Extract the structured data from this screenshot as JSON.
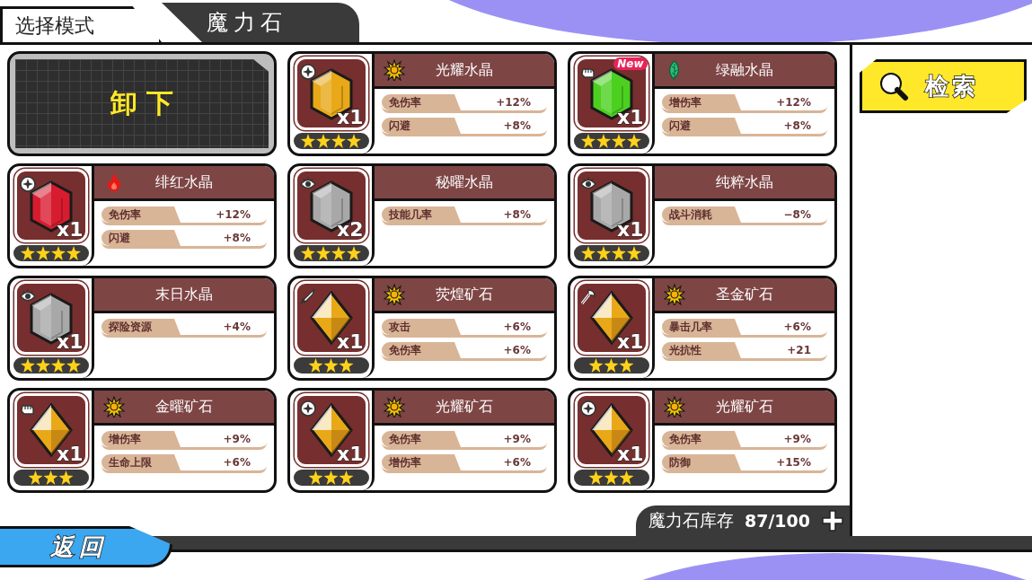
{
  "header": {
    "mode_tab": "选择模式",
    "title": "魔力石"
  },
  "unequip_button": "卸 下",
  "stones": [
    {
      "name": "光耀水晶",
      "element": {
        "kind": "sun"
      },
      "badge": {
        "kind": "target"
      },
      "gem": {
        "kind": "crystal",
        "color": "#e8a818"
      },
      "count": "x1",
      "stars": 4,
      "stats": [
        {
          "label": "免伤率",
          "value": "+12%"
        },
        {
          "label": "闪避",
          "value": "+8%"
        }
      ]
    },
    {
      "name": "绿融水晶",
      "element": {
        "kind": "leaf"
      },
      "badge": {
        "kind": "fist"
      },
      "gem": {
        "kind": "crystal",
        "color": "#4cd020"
      },
      "count": "x1",
      "stars": 4,
      "new_label": "New",
      "stats": [
        {
          "label": "增伤率",
          "value": "+12%"
        },
        {
          "label": "闪避",
          "value": "+8%"
        }
      ]
    },
    {
      "name": "绯红水晶",
      "element": {
        "kind": "fire"
      },
      "badge": {
        "kind": "target"
      },
      "gem": {
        "kind": "crystal",
        "color": "#d81c30"
      },
      "count": "x1",
      "stars": 4,
      "stats": [
        {
          "label": "免伤率",
          "value": "+12%"
        },
        {
          "label": "闪避",
          "value": "+8%"
        }
      ]
    },
    {
      "name": "秘曜水晶",
      "badge": {
        "kind": "eye"
      },
      "gem": {
        "kind": "crystal",
        "color": "#a8a8a8"
      },
      "count": "x2",
      "stars": 4,
      "stats": [
        {
          "label": "技能几率",
          "value": "+8%"
        }
      ]
    },
    {
      "name": "纯粹水晶",
      "badge": {
        "kind": "eye"
      },
      "gem": {
        "kind": "crystal",
        "color": "#a8a8a8"
      },
      "count": "x1",
      "stars": 4,
      "stats": [
        {
          "label": "战斗消耗",
          "value": "−8%"
        }
      ]
    },
    {
      "name": "末日水晶",
      "badge": {
        "kind": "eye"
      },
      "gem": {
        "kind": "crystal",
        "color": "#a8a8a8"
      },
      "count": "x1",
      "stars": 4,
      "stats": [
        {
          "label": "探险资源",
          "value": "+4%"
        }
      ]
    },
    {
      "name": "荧煌矿石",
      "element": {
        "kind": "sun"
      },
      "badge": {
        "kind": "sword"
      },
      "gem": {
        "kind": "ore",
        "color": "#e8a818"
      },
      "count": "x1",
      "stars": 3,
      "stats": [
        {
          "label": "攻击",
          "value": "+6%"
        },
        {
          "label": "免伤率",
          "value": "+6%"
        }
      ]
    },
    {
      "name": "圣金矿石",
      "element": {
        "kind": "sun"
      },
      "badge": {
        "kind": "axe"
      },
      "gem": {
        "kind": "ore",
        "color": "#e8a818"
      },
      "count": "x1",
      "stars": 3,
      "stats": [
        {
          "label": "暴击几率",
          "value": "+6%"
        },
        {
          "label": "光抗性",
          "value": "+21"
        }
      ]
    },
    {
      "name": "金曜矿石",
      "element": {
        "kind": "sun"
      },
      "badge": {
        "kind": "fist"
      },
      "gem": {
        "kind": "ore",
        "color": "#e8a818"
      },
      "count": "x1",
      "stars": 3,
      "stats": [
        {
          "label": "增伤率",
          "value": "+9%"
        },
        {
          "label": "生命上限",
          "value": "+6%"
        }
      ]
    },
    {
      "name": "光耀矿石",
      "element": {
        "kind": "sun"
      },
      "badge": {
        "kind": "target"
      },
      "gem": {
        "kind": "ore",
        "color": "#e8a818"
      },
      "count": "x1",
      "stars": 3,
      "stats": [
        {
          "label": "免伤率",
          "value": "+9%"
        },
        {
          "label": "增伤率",
          "value": "+6%"
        }
      ]
    },
    {
      "name": "光耀矿石",
      "element": {
        "kind": "sun"
      },
      "badge": {
        "kind": "target"
      },
      "gem": {
        "kind": "ore",
        "color": "#e8a818"
      },
      "count": "x1",
      "stars": 3,
      "stats": [
        {
          "label": "免伤率",
          "value": "+9%"
        },
        {
          "label": "防御",
          "value": "+15%"
        }
      ]
    }
  ],
  "search_button": "检索",
  "inventory": {
    "label": "魔力石库存",
    "count": "87/100"
  },
  "back_button": "返回"
}
